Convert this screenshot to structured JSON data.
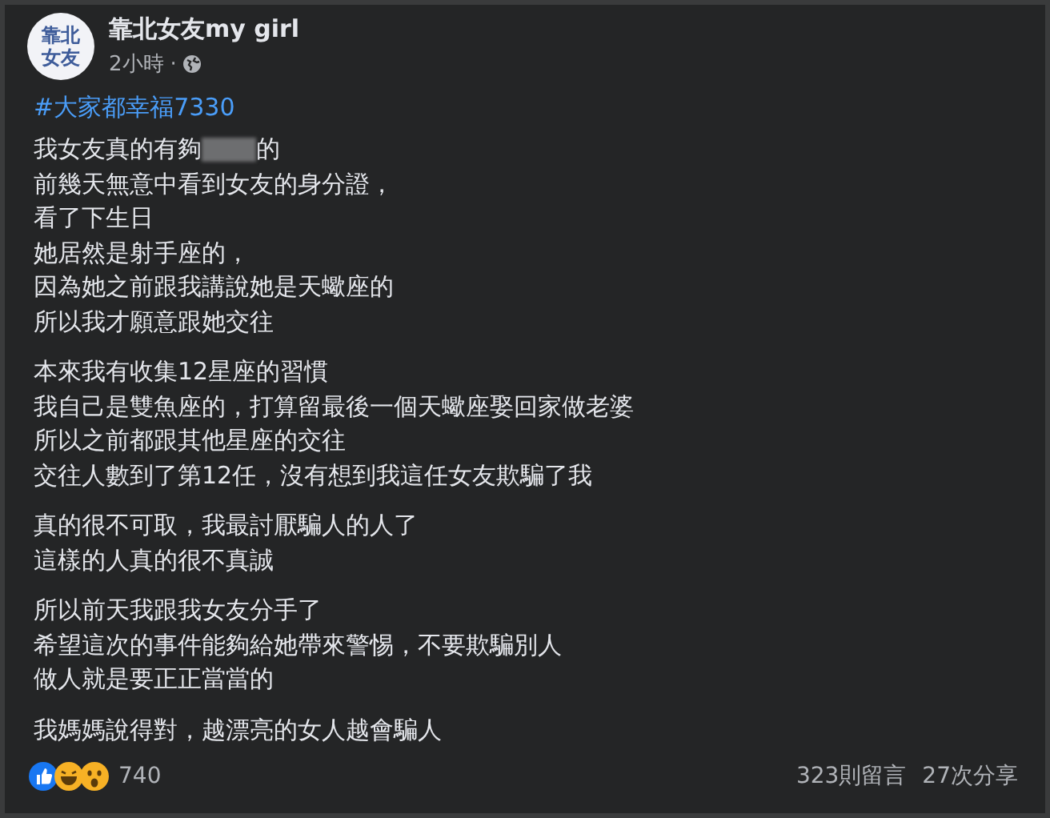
{
  "post": {
    "author": "靠北女友my girl",
    "avatar_text": [
      "靠北",
      "女友"
    ],
    "time": "2小時",
    "separator": "·",
    "hashtag": "#大家都幸福7330",
    "paragraphs": [
      [
        {
          "before": "我女友真的有夠",
          "redacted": true,
          "after": "的"
        },
        "前幾天無意中看到女友的身分證，",
        "看了下生日",
        "她居然是射手座的，",
        "因為她之前跟我講說她是天蠍座的",
        "所以我才願意跟她交往"
      ],
      [
        "本來我有收集12星座的習慣",
        "我自己是雙魚座的，打算留最後一個天蠍座娶回家做老婆",
        "所以之前都跟其他星座的交往",
        "交往人數到了第12任，沒有想到我這任女友欺騙了我"
      ],
      [
        "真的很不可取，我最討厭騙人的人了",
        "這樣的人真的很不真誠"
      ],
      [
        "所以前天我跟我女友分手了",
        "希望這次的事件能夠給她帶來警惕，不要欺騙別人",
        "做人就是要正正當當的"
      ],
      [
        "我媽媽說得對，越漂亮的女人越會騙人"
      ]
    ],
    "reactions": [
      {
        "kind": "like"
      },
      {
        "kind": "haha"
      },
      {
        "kind": "wow"
      }
    ],
    "reaction_count": "740",
    "comments": "323則留言",
    "shares": "27次分享"
  }
}
